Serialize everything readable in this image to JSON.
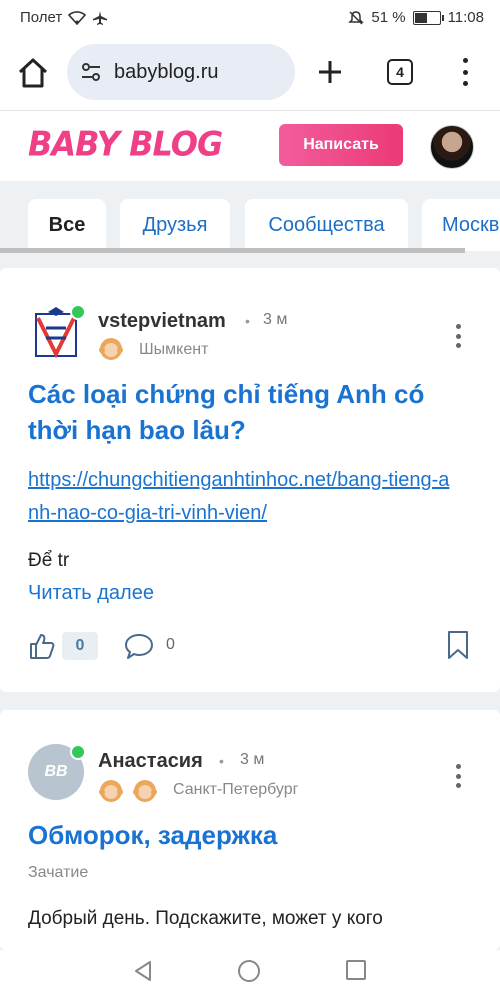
{
  "status_bar": {
    "carrier": "Полет",
    "battery_text": "51 %",
    "battery_level": 0.51,
    "time": "11:08",
    "icons": [
      "wifi-icon",
      "airplane-icon",
      "mute-icon",
      "battery-icon"
    ]
  },
  "browser": {
    "url": "babyblog.ru",
    "tab_count": "4",
    "icons": [
      "home-icon",
      "site-settings-icon",
      "new-tab-icon",
      "tabs-icon",
      "more-icon"
    ]
  },
  "site_header": {
    "logo_text": "BABY BLOG",
    "write_button": "Написать",
    "brand_color": "#ee3f87",
    "link_color": "#1a73d1"
  },
  "tabs": [
    {
      "label": "Все",
      "active": true
    },
    {
      "label": "Друзья",
      "active": false
    },
    {
      "label": "Сообщества",
      "active": false
    },
    {
      "label": "Москва",
      "active": false
    }
  ],
  "posts": [
    {
      "author": "vstepvietnam",
      "separator": "•",
      "time": "3 м",
      "city": "Шымкент",
      "title": "Các loại chứng chỉ tiếng Anh có thời hạn bao lâu?",
      "link": "https://chungchitienganhtinhoc.net/bang-tieng-anh-nao-co-gia-tri-vinh-vien/",
      "excerpt": "Để tr",
      "read_more": "Читать далее",
      "likes": "0",
      "comments": "0"
    },
    {
      "author": "Анастасия",
      "separator": "•",
      "time": "3 м",
      "city": "Санкт-Петербург",
      "avatar_initials": "BB",
      "title": "Обморок, задержка",
      "category": "Зачатие",
      "excerpt": "Добрый день. Подскажите, может у кого"
    }
  ]
}
